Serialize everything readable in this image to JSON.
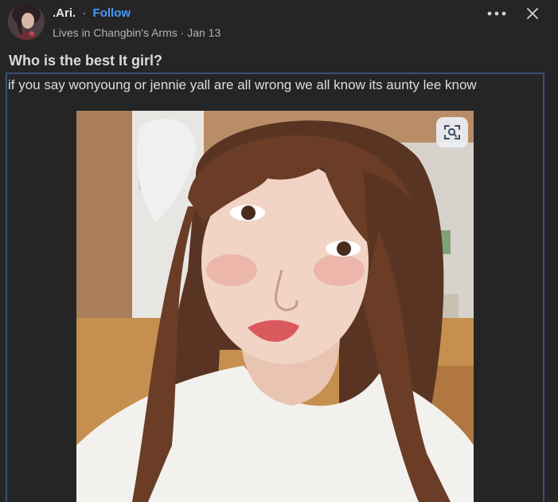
{
  "header": {
    "author_name": ".Ari.",
    "separator": "·",
    "follow_label": "Follow",
    "meta": "Lives in Changbin's Arms · Jan 13",
    "more_icon": "more-horizontal-icon",
    "close_icon": "close-icon"
  },
  "post": {
    "title": "Who is the best It girl?",
    "body": "if you say wonyoung or jennie yall are all wrong we all know its aunty lee know",
    "image_action_icon": "visual-search-icon"
  },
  "colors": {
    "background": "#252526",
    "link": "#4599ff",
    "border": "#3a4e7a",
    "text": "#dcdde0",
    "muted": "#b0b3b8"
  }
}
